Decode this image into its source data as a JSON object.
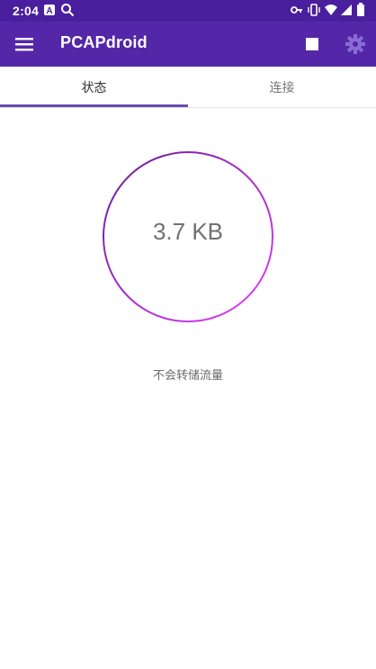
{
  "status_bar": {
    "time": "2:04",
    "icons": [
      "a-notification-icon",
      "search-notification-icon",
      "vpn-key-icon",
      "vibrate-icon",
      "wifi-icon",
      "signal-icon",
      "battery-icon"
    ]
  },
  "app_bar": {
    "title": "PCAPdroid",
    "menu_icon": "menu-icon",
    "stop_icon": "stop-icon",
    "settings_icon": "gear-icon",
    "color": "#5427a8"
  },
  "tabs": [
    {
      "label": "状态",
      "active": true
    },
    {
      "label": "连接",
      "active": false
    }
  ],
  "status": {
    "traffic_total": "3.7 KB",
    "dump_mode": "不会转储流量"
  },
  "colors": {
    "accent": "#6a4bb3",
    "ring_start": "#6a1b9a",
    "ring_end": "#e040fb"
  }
}
